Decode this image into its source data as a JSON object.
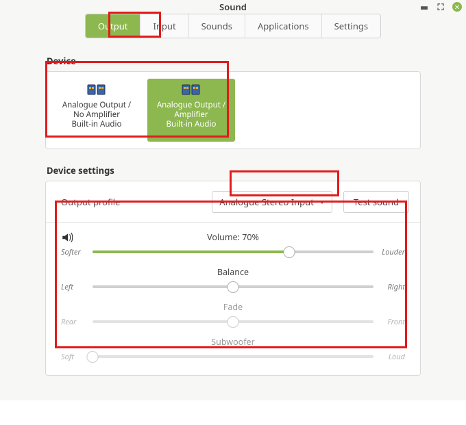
{
  "window": {
    "title": "Sound"
  },
  "tabs": [
    {
      "label": "Output",
      "active": true
    },
    {
      "label": "Input"
    },
    {
      "label": "Sounds"
    },
    {
      "label": "Applications"
    },
    {
      "label": "Settings"
    }
  ],
  "sections": {
    "device_label": "Device",
    "device_settings_label": "Device settings"
  },
  "devices": [
    {
      "line1": "Analogue Output /",
      "line2": "No Amplifier",
      "line3": "Built-in Audio",
      "active": false
    },
    {
      "line1": "Analogue Output /",
      "line2": "Amplifier",
      "line3": "Built-in Audio",
      "active": true
    }
  ],
  "profile": {
    "label": "Output profile",
    "selected": "Analogue Stereo Input",
    "test_button": "Test sound"
  },
  "sliders": {
    "volume": {
      "title": "Volume: 70%",
      "left": "Softer",
      "right": "Louder",
      "pct": 70,
      "fill": true,
      "dim": false
    },
    "balance": {
      "title": "Balance",
      "left": "Left",
      "right": "Right",
      "pct": 50,
      "fill": false,
      "dim": false
    },
    "fade": {
      "title": "Fade",
      "left": "Rear",
      "right": "Front",
      "pct": 50,
      "fill": false,
      "dim": true
    },
    "subwoofer": {
      "title": "Subwoofer",
      "left": "Soft",
      "right": "Loud",
      "pct": 0,
      "fill": false,
      "dim": true
    }
  }
}
